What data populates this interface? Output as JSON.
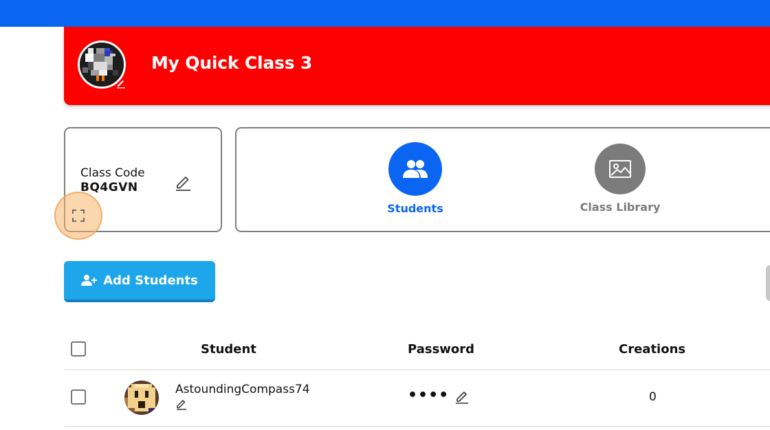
{
  "header": {
    "class_name": "My Quick Class 3",
    "avatar_icon": "pixel-bird-avatar",
    "accent": "#fe0000"
  },
  "top_bar": {
    "color": "#0a66f2"
  },
  "class_code": {
    "label": "Class Code",
    "value": "BQ4GVN",
    "edit_icon": "pencil-icon",
    "fullscreen_icon": "expand-icon"
  },
  "tabs": [
    {
      "label": "Students",
      "icon": "users-icon",
      "active": true,
      "color": "#0a66f2"
    },
    {
      "label": "Class Library",
      "icon": "image-icon",
      "active": false,
      "color": "#7b7b7b"
    }
  ],
  "actions": {
    "add_students_label": "Add Students",
    "add_students_icon": "add-user-icon",
    "color": "#1ea6eb"
  },
  "table": {
    "columns": [
      "Student",
      "Password",
      "Creations"
    ],
    "rows": [
      {
        "student": "AstoundingCompass74",
        "avatar_icon": "pixel-ghost-avatar",
        "password": "••••",
        "creations": "0"
      }
    ]
  }
}
